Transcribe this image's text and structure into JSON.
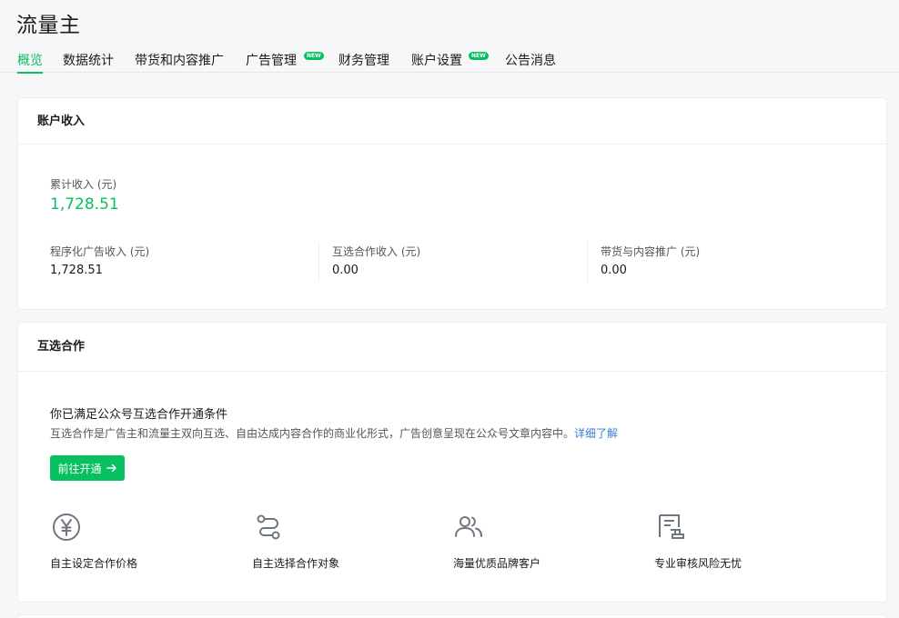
{
  "app": {
    "title": "流量主"
  },
  "nav": {
    "tabs": [
      {
        "label": "概览",
        "active": true
      },
      {
        "label": "数据统计"
      },
      {
        "label": "带货和内容推广"
      },
      {
        "label": "广告管理",
        "badge": "NEW"
      },
      {
        "label": "财务管理"
      },
      {
        "label": "账户设置",
        "badge": "NEW"
      },
      {
        "label": "公告消息"
      }
    ]
  },
  "income": {
    "header": "账户收入",
    "total_label": "累计收入 (元)",
    "total_value": "1,728.51",
    "items": [
      {
        "label": "程序化广告收入 (元)",
        "value": "1,728.51"
      },
      {
        "label": "互选合作收入 (元)",
        "value": "0.00"
      },
      {
        "label": "带货与内容推广 (元)",
        "value": "0.00"
      }
    ]
  },
  "coop": {
    "header": "互选合作",
    "title": "你已满足公众号互选合作开通条件",
    "desc": "互选合作是广告主和流量主双向互选、自由达成内容合作的商业化形式，广告创意呈现在公众号文章内容中。",
    "link": "详细了解",
    "button": "前往开通",
    "features": [
      {
        "icon": "yen-circle-icon",
        "label": "自主设定合作价格"
      },
      {
        "icon": "route-icon",
        "label": "自主选择合作对象"
      },
      {
        "icon": "users-icon",
        "label": "海量优质品牌客户"
      },
      {
        "icon": "audit-document-icon",
        "label": "专业审核风险无忧"
      }
    ]
  },
  "colors": {
    "accent": "#07c160",
    "link": "#3a7fd5"
  }
}
